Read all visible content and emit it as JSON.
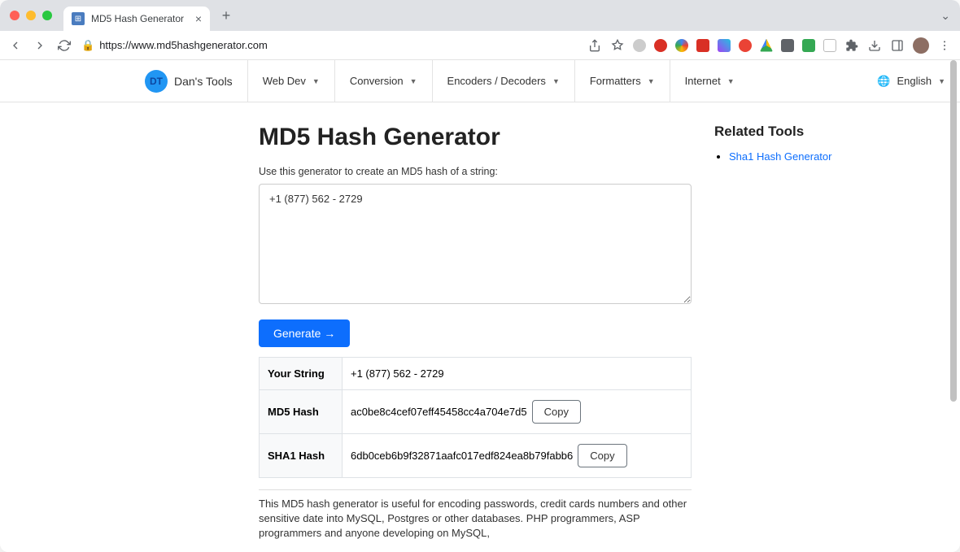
{
  "browser": {
    "tab_title": "MD5 Hash Generator",
    "url": "https://www.md5hashgenerator.com"
  },
  "nav": {
    "brand": "Dan's Tools",
    "items": [
      "Web Dev",
      "Conversion",
      "Encoders / Decoders",
      "Formatters",
      "Internet"
    ],
    "language": "English"
  },
  "main": {
    "title": "MD5 Hash Generator",
    "subtitle": "Use this generator to create an MD5 hash of a string:",
    "input_value": "+1 (877) 562 - 2729",
    "generate_label": "Generate →",
    "table": {
      "row0": {
        "label": "Your String",
        "value": "+1 (877) 562 - 2729"
      },
      "row1": {
        "label": "MD5 Hash",
        "value": "ac0be8c4cef07eff45458cc4a704e7d5",
        "copy": "Copy"
      },
      "row2": {
        "label": "SHA1 Hash",
        "value": "6db0ceb6b9f32871aafc017edf824ea8b79fabb6",
        "copy": "Copy"
      }
    },
    "description": "This MD5 hash generator is useful for encoding passwords, credit cards numbers and other sensitive date into MySQL, Postgres or other databases. PHP programmers, ASP programmers and anyone developing on MySQL,"
  },
  "sidebar": {
    "title": "Related Tools",
    "links": [
      "Sha1 Hash Generator"
    ]
  }
}
